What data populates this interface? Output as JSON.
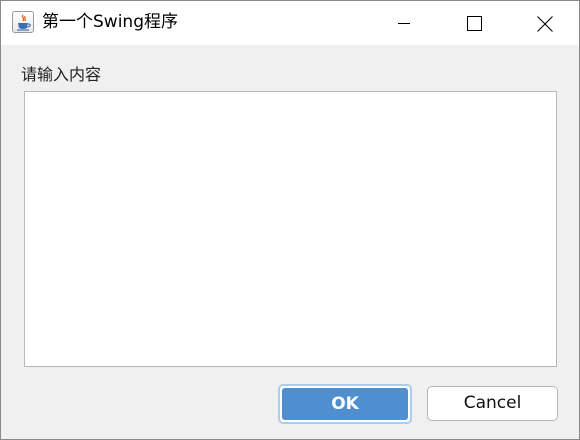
{
  "window": {
    "title": "第一个Swing程序",
    "app_icon": "java-coffee-cup-icon",
    "controls": {
      "minimize_icon": "minimize-icon",
      "maximize_icon": "maximize-icon",
      "close_icon": "close-icon"
    }
  },
  "form": {
    "prompt_label": "请输入内容",
    "text_area_value": ""
  },
  "buttons": {
    "ok_label": "OK",
    "cancel_label": "Cancel"
  },
  "colors": {
    "ok_fill": "#4f8fcf",
    "ok_focus_ring": "#a9cdef",
    "window_background": "#f0f0f0",
    "titlebar_background": "#ffffff"
  }
}
